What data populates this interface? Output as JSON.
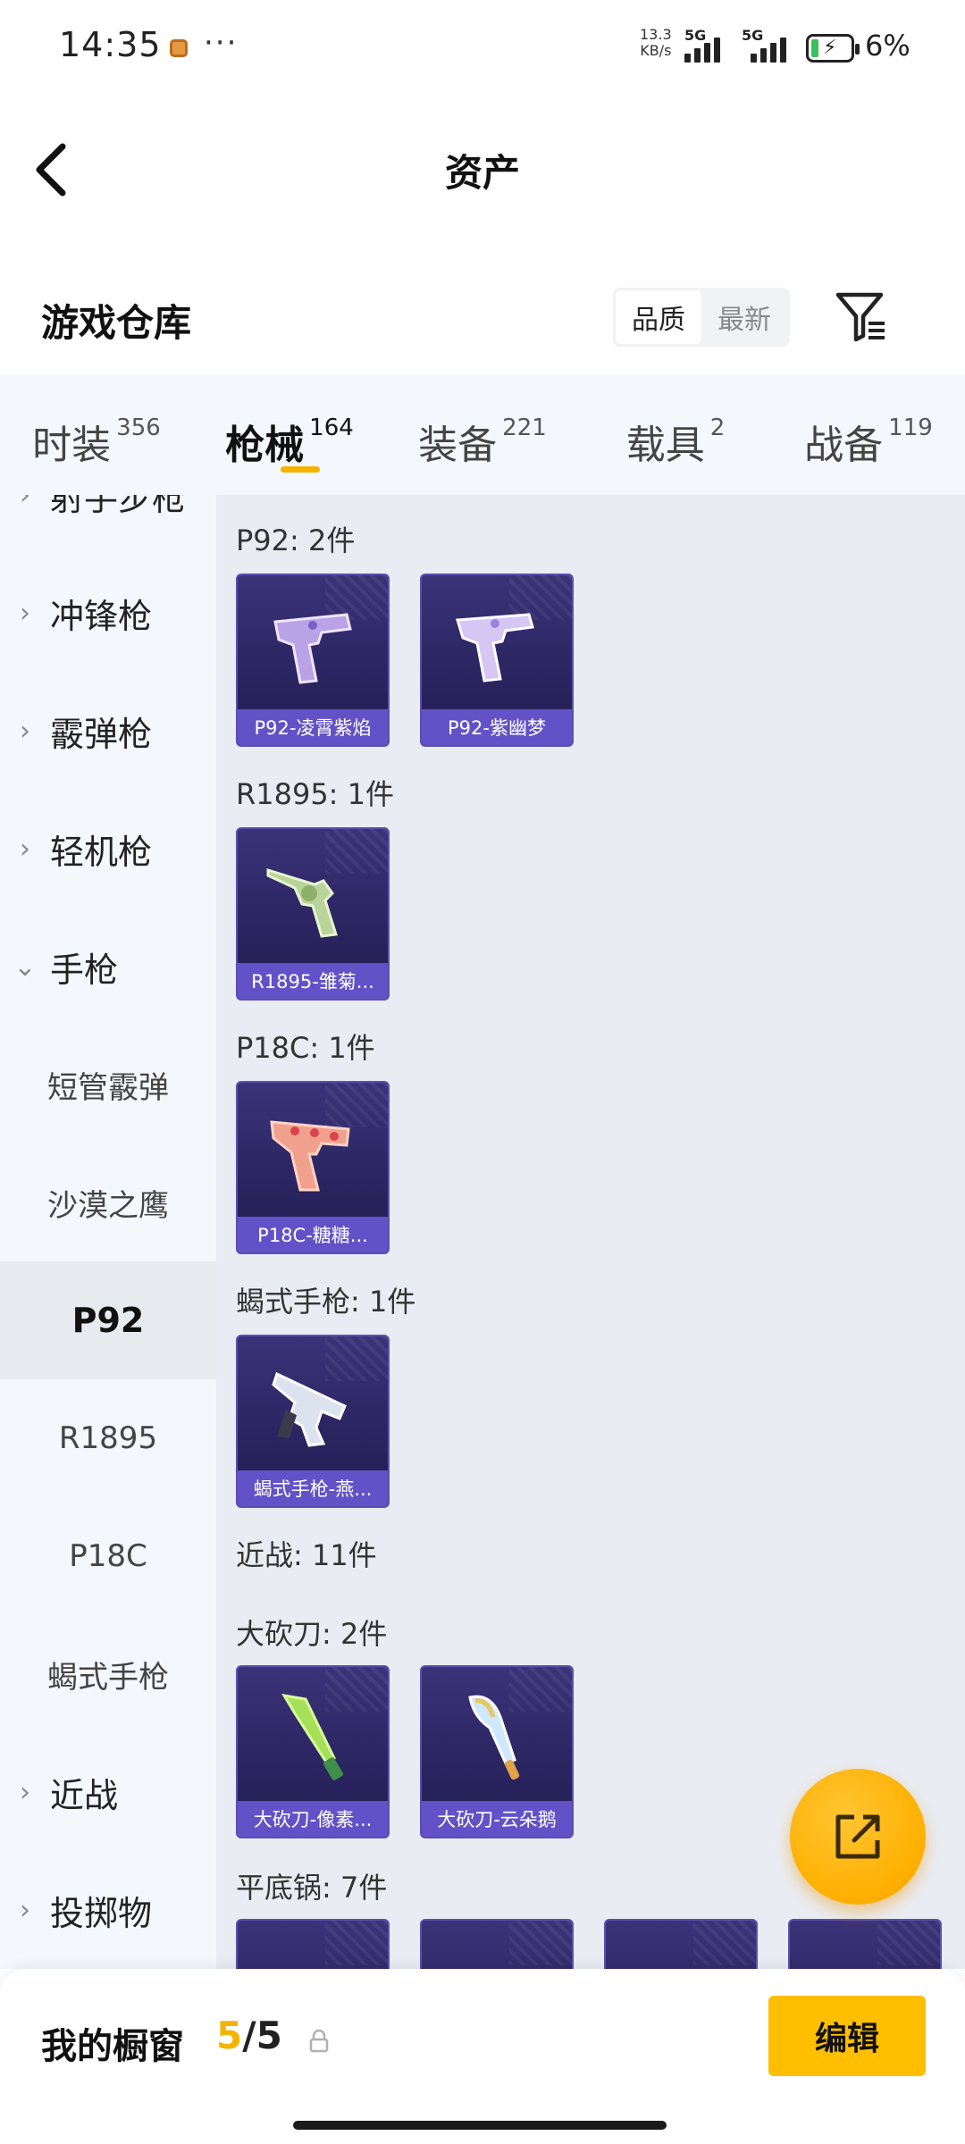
{
  "status_bar": {
    "time": "14:35",
    "dots": "···",
    "net_speed_value": "13.3",
    "net_speed_unit": "KB/s",
    "signal1_label": "5G",
    "signal2_label": "5G",
    "battery_percent": "6%"
  },
  "header": {
    "title": "资产"
  },
  "warehouse": {
    "title": "游戏仓库",
    "sort_options": [
      "品质",
      "最新"
    ],
    "sort_selected": "品质"
  },
  "tabs": [
    {
      "label": "时装",
      "count": "356"
    },
    {
      "label": "枪械",
      "count": "164",
      "active": true
    },
    {
      "label": "装备",
      "count": "221"
    },
    {
      "label": "载具",
      "count": "2"
    },
    {
      "label": "战备",
      "count": "119"
    }
  ],
  "sidebar": {
    "partial_item": "射手步枪",
    "items": [
      {
        "label": "冲锋枪"
      },
      {
        "label": "霰弹枪"
      },
      {
        "label": "轻机枪"
      },
      {
        "label": "手枪",
        "expanded": true
      }
    ],
    "subitems": [
      "短管霰弹",
      "沙漠之鹰",
      "P92",
      "R1895",
      "P18C",
      "蝎式手枪"
    ],
    "selected_subitem": "P92",
    "after_items": [
      {
        "label": "近战"
      },
      {
        "label": "投掷物"
      }
    ]
  },
  "content": {
    "groups": [
      {
        "heading": "P92: 2件",
        "items": [
          "P92-凌霄紫焰",
          "P92-紫幽梦"
        ]
      },
      {
        "heading": "R1895: 1件",
        "items": [
          "R1895-雏菊..."
        ]
      },
      {
        "heading": "P18C: 1件",
        "items": [
          "P18C-糖糖..."
        ]
      },
      {
        "heading": "蝎式手枪: 1件",
        "items": [
          "蝎式手枪-燕..."
        ]
      },
      {
        "heading": "近战: 11件",
        "items": []
      },
      {
        "heading": "大砍刀: 2件",
        "items": [
          "大砍刀-像素...",
          "大砍刀-云朵鹅"
        ]
      },
      {
        "heading": "平底锅: 7件",
        "items": []
      }
    ]
  },
  "bottom_bar": {
    "label": "我的橱窗",
    "current": "5",
    "separator": "/",
    "max": "5",
    "edit_label": "编辑"
  },
  "colors": {
    "accent": "#ffbe00",
    "card_bg": "#2a2460",
    "card_caption": "#6e5adc",
    "tab_bg": "#f4f8fd",
    "content_bg": "#e9edf3"
  }
}
